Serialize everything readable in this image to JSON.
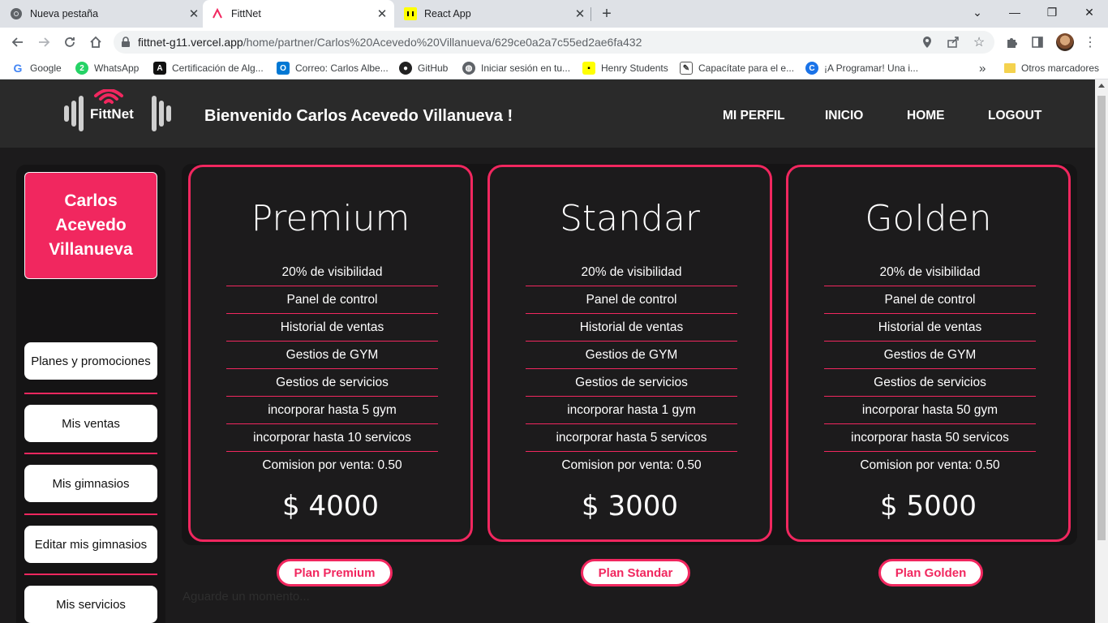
{
  "browser": {
    "tabs": [
      {
        "title": "Nueva pestaña"
      },
      {
        "title": "FittNet"
      },
      {
        "title": "React App"
      }
    ],
    "url_host": "fittnet-g11.vercel.app",
    "url_path": "/home/partner/Carlos%20Acevedo%20Villanueva/629ce0a2a7c55ed2ae6fa432",
    "bookmarks": [
      {
        "label": "Google"
      },
      {
        "label": "WhatsApp"
      },
      {
        "label": "Certificación de Alg..."
      },
      {
        "label": "Correo: Carlos Albe..."
      },
      {
        "label": "GitHub"
      },
      {
        "label": "Iniciar sesión en tu..."
      },
      {
        "label": "Henry Students"
      },
      {
        "label": "Capacítate para el e..."
      },
      {
        "label": "¡A Programar! Una i..."
      }
    ],
    "bookmarks_overflow": "»",
    "other_bookmarks": "Otros marcadores"
  },
  "header": {
    "logo_text": "FittNet",
    "welcome": "Bienvenido Carlos Acevedo Villanueva !",
    "nav": [
      {
        "label": "MI PERFIL"
      },
      {
        "label": "INICIO"
      },
      {
        "label": "HOME"
      },
      {
        "label": "LOGOUT"
      }
    ]
  },
  "sidebar": {
    "user_name": "Carlos Acevedo Villanueva",
    "items": [
      {
        "label": "Planes y promociones"
      },
      {
        "label": "Mis ventas"
      },
      {
        "label": "Mis gimnasios"
      },
      {
        "label": "Editar mis gimnasios"
      },
      {
        "label": "Mis servicios"
      }
    ]
  },
  "plans": [
    {
      "title": "Premium",
      "features": [
        "20% de visibilidad",
        "Panel de control",
        "Historial de ventas",
        "Gestios de GYM",
        "Gestios de servicios",
        "incorporar hasta 5 gym",
        "incorporar hasta 10 servicos",
        "Comision por venta: 0.50"
      ],
      "price": "$ 4000",
      "button": "Plan Premium"
    },
    {
      "title": "Standar",
      "features": [
        "20% de visibilidad",
        "Panel de control",
        "Historial de ventas",
        "Gestios de GYM",
        "Gestios de servicios",
        "incorporar hasta 1 gym",
        "incorporar hasta 5 servicos",
        "Comision por venta: 0.50"
      ],
      "price": "$ 3000",
      "button": "Plan Standar"
    },
    {
      "title": "Golden",
      "features": [
        "20% de visibilidad",
        "Panel de control",
        "Historial de ventas",
        "Gestios de GYM",
        "Gestios de servicios",
        "incorporar hasta 50 gym",
        "incorporar hasta 50 servicos",
        "Comision por venta: 0.50"
      ],
      "price": "$ 5000",
      "button": "Plan Golden"
    }
  ],
  "loading_text": "Aguarde un momento...",
  "colors": {
    "accent": "#f1275f",
    "background": "#1c1b1c",
    "header": "#2a2a2a",
    "panel": "#151415"
  }
}
